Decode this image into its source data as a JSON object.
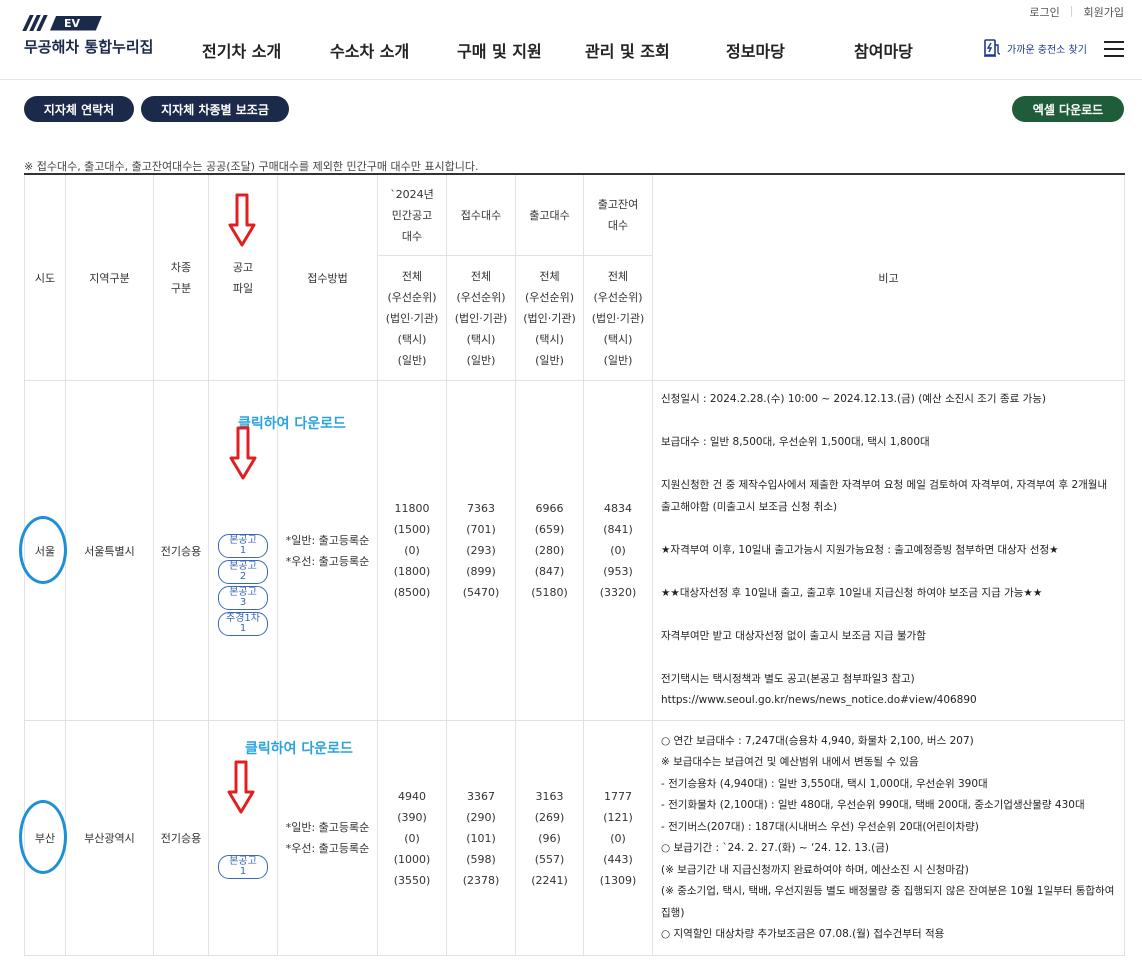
{
  "header": {
    "util_links": [
      "로그인",
      "회원가입"
    ],
    "logo_badge": "EV",
    "site_title": "무공해차 통합누리집",
    "nav": [
      "전기차 소개",
      "수소차 소개",
      "구매 및 지원",
      "관리 및 조회",
      "정보마당",
      "참여마당"
    ],
    "charger_link": "가까운 충전소 찾기"
  },
  "buttons": {
    "contact": "지자체 연락처",
    "subsidy": "지자체 차종별 보조금",
    "excel": "엑셀 다운로드"
  },
  "note": "※ 접수대수, 출고대수, 출고잔여대수는 공공(조달) 구매대수를 제외한 민간구매 대수만 표시합니다.",
  "table": {
    "headers": {
      "sido": "시도",
      "region": "지역구분",
      "car_type": [
        "차종",
        "구분"
      ],
      "notice_file": [
        "공고",
        "파일"
      ],
      "method": "접수방법",
      "announce": [
        "`2024년",
        "민간공고",
        "대수"
      ],
      "received": "접수대수",
      "released": "출고대수",
      "remaining": [
        "출고잔여",
        "대수"
      ],
      "remarks": "비고",
      "sub": [
        "전체",
        "(우선순위)",
        "(법인·기관)",
        "(택시)",
        "(일반)"
      ]
    },
    "rows": [
      {
        "sido": "서울",
        "region": "서울특별시",
        "car_type": "전기승용",
        "annotation": "클릭하여 다운로드",
        "files": [
          [
            "본공고",
            "1"
          ],
          [
            "본공고",
            "2"
          ],
          [
            "본공고",
            "3"
          ],
          [
            "추경1차",
            "1"
          ]
        ],
        "method": [
          "*일반: 출고등록순",
          "*우선: 출고등록순"
        ],
        "announce": [
          "11800",
          "(1500)",
          "(0)",
          "(1800)",
          "(8500)"
        ],
        "received": [
          "7363",
          "(701)",
          "(293)",
          "(899)",
          "(5470)"
        ],
        "released": [
          "6966",
          "(659)",
          "(280)",
          "(847)",
          "(5180)"
        ],
        "remaining": [
          "4834",
          "(841)",
          "(0)",
          "(953)",
          "(3320)"
        ],
        "remarks": [
          "신청일시 : 2024.2.28.(수) 10:00 ~ 2024.12.13.(금) (예산 소진시 조기 종료 가능)",
          "",
          "보급대수 : 일반 8,500대, 우선순위 1,500대, 택시 1,800대",
          "",
          "지원신청한 건 중 제작수입사에서 제출한 자격부여 요청 메일 검토하여 자격부여, 자격부여 후 2개월내",
          "출고해야함 (미출고시 보조금 신청 취소)",
          "",
          "★자격부여 이후, 10일내 출고가능시 지원가능요청 : 출고예정증빙 첨부하면 대상자 선정★",
          "",
          "★★대상자선정 후 10일내 출고, 출고후 10일내 지급신청 하여야 보조금 지급 가능★★",
          "",
          "자격부여만 받고 대상자선정 없이 출고시 보조금 지급 불가함",
          "",
          "전기택시는 택시정책과 별도 공고(본공고 첨부파일3 참고)",
          "https://www.seoul.go.kr/news/news_notice.do#view/406890"
        ]
      },
      {
        "sido": "부산",
        "region": "부산광역시",
        "car_type": "전기승용",
        "annotation": "클릭하여 다운로드",
        "files": [
          [
            "본공고",
            "1"
          ]
        ],
        "method": [
          "*일반: 출고등록순",
          "*우선: 출고등록순"
        ],
        "announce": [
          "4940",
          "(390)",
          "(0)",
          "(1000)",
          "(3550)"
        ],
        "received": [
          "3367",
          "(290)",
          "(101)",
          "(598)",
          "(2378)"
        ],
        "released": [
          "3163",
          "(269)",
          "(96)",
          "(557)",
          "(2241)"
        ],
        "remaining": [
          "1777",
          "(121)",
          "(0)",
          "(443)",
          "(1309)"
        ],
        "remarks": [
          "○ 연간 보급대수 : 7,247대(승용차 4,940, 화물차 2,100, 버스 207)",
          "※ 보급대수는 보급여건 및 예산범위 내에서 변동될 수 있음",
          "- 전기승용차 (4,940대) : 일반 3,550대, 택시 1,000대, 우선순위 390대",
          "- 전기화물차 (2,100대) : 일반 480대, 우선순위 990대, 택배 200대, 중소기업생산물량 430대",
          "- 전기버스(207대) : 187대(시내버스 우선) 우선순위 20대(어린이차량)",
          "○ 보급기간 : `24. 2. 27.(화) ~ ‘24. 12. 13.(금)",
          "(※ 보급기간 내 지급신청까지 완료하여야 하며, 예산소진 시 신청마감)",
          "(※ 중소기업, 택시, 택배, 우선지원등 별도 배정물량 중 집행되지 않은 잔여분은 10월 1일부터 통합하여",
          "집행)",
          "○ 지역할인 대상차량 추가보조금은 07.08.(월) 접수건부터 적용"
        ]
      }
    ]
  },
  "colors": {
    "navy": "#1b2a4a",
    "green": "#1f5c3a",
    "annotation": "#2aa3df",
    "arrow": "#e02020",
    "circle": "#1e90d8"
  }
}
